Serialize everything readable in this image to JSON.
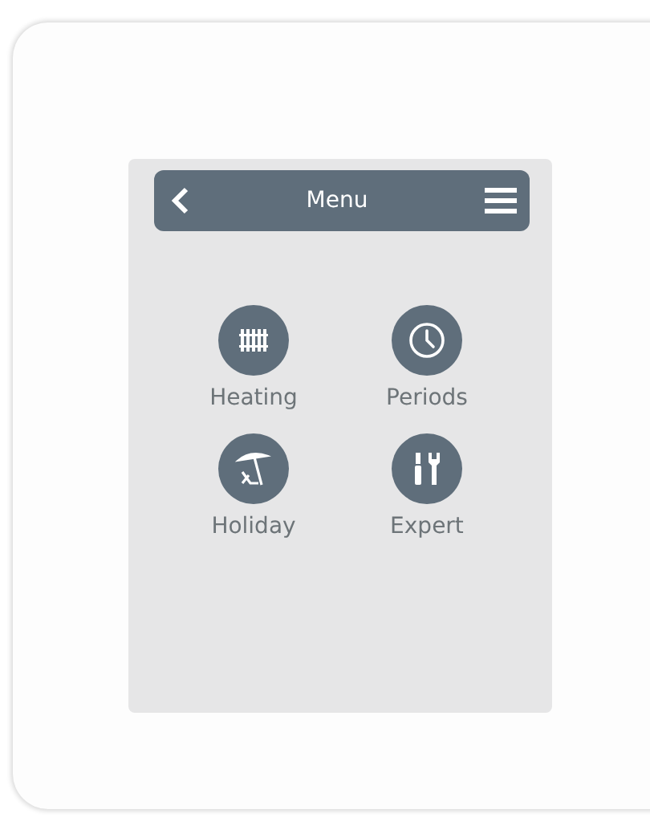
{
  "header": {
    "title": "Menu"
  },
  "items": [
    {
      "label": "Heating",
      "kind": "radiator"
    },
    {
      "label": "Periods",
      "kind": "clock"
    },
    {
      "label": "Holiday",
      "kind": "deckchair"
    },
    {
      "label": "Expert",
      "kind": "tools"
    }
  ]
}
